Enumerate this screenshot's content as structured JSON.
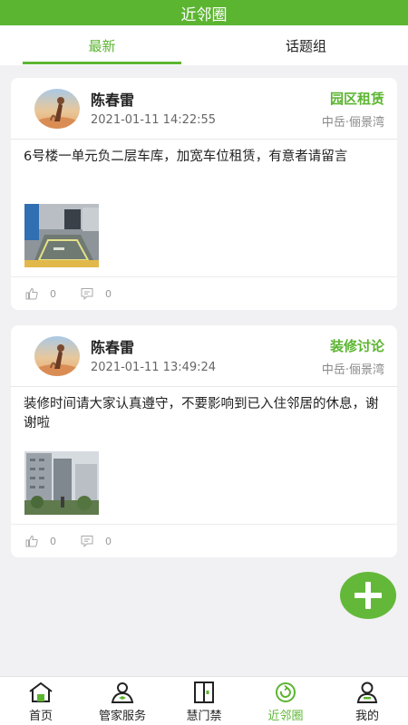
{
  "header": {
    "title": "近邻圈"
  },
  "tabs": [
    {
      "label": "最新",
      "active": true
    },
    {
      "label": "话题组",
      "active": false
    }
  ],
  "posts": [
    {
      "author": "陈春雷",
      "time": "2021-01-11 14:22:55",
      "category": "园区租赁",
      "location": "中岳·俪景湾",
      "content": "6号楼一单元负二层车库，加宽车位租赁，有意者请留言",
      "likes": "0",
      "comments": "0"
    },
    {
      "author": "陈春雷",
      "time": "2021-01-11 13:49:24",
      "category": "装修讨论",
      "location": "中岳·俪景湾",
      "content": "装修时间请大家认真遵守，不要影响到已入住邻居的休息，谢谢啦",
      "likes": "0",
      "comments": "0"
    }
  ],
  "nav": [
    {
      "label": "首页",
      "icon": "home-icon"
    },
    {
      "label": "管家服务",
      "icon": "butler-icon"
    },
    {
      "label": "慧门禁",
      "icon": "door-icon"
    },
    {
      "label": "近邻圈",
      "icon": "neighbor-circle-icon",
      "active": true
    },
    {
      "label": "我的",
      "icon": "profile-icon"
    }
  ],
  "colors": {
    "accent": "#5cb531",
    "background": "#f1f0f2"
  }
}
